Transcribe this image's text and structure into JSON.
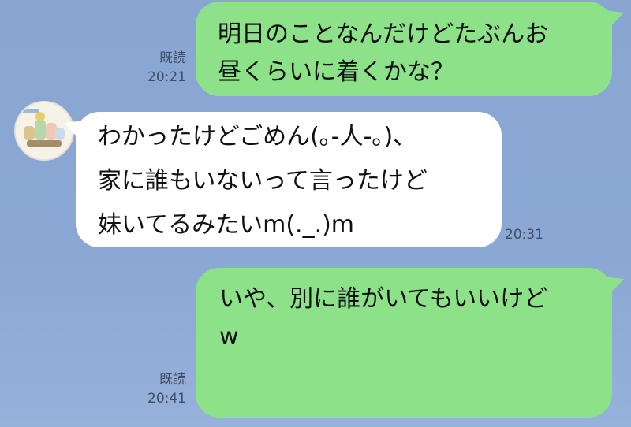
{
  "messages": [
    {
      "side": "out",
      "lines": [
        "明日のことなんだけどたぶんお",
        "昼くらいに着くかな？"
      ],
      "read_label": "既読",
      "time": "20:21"
    },
    {
      "side": "in",
      "lines": [
        "わかったけどごめん(｡-人-｡)、",
        "家に誰もいないって言ったけど",
        "妹いてるみたいm(._.)m"
      ],
      "time": "20:31"
    },
    {
      "side": "out",
      "lines": [
        "いや、別に誰がいてもいいけど",
        "w"
      ],
      "read_label": "既読",
      "time": "20:41"
    }
  ],
  "colors": {
    "background": "#8aa7d3",
    "outgoing_bubble": "#8de189",
    "incoming_bubble": "#ffffff",
    "meta_text": "#3f4d66"
  },
  "icons": {
    "avatar": "sticker-character-avatar-icon"
  }
}
